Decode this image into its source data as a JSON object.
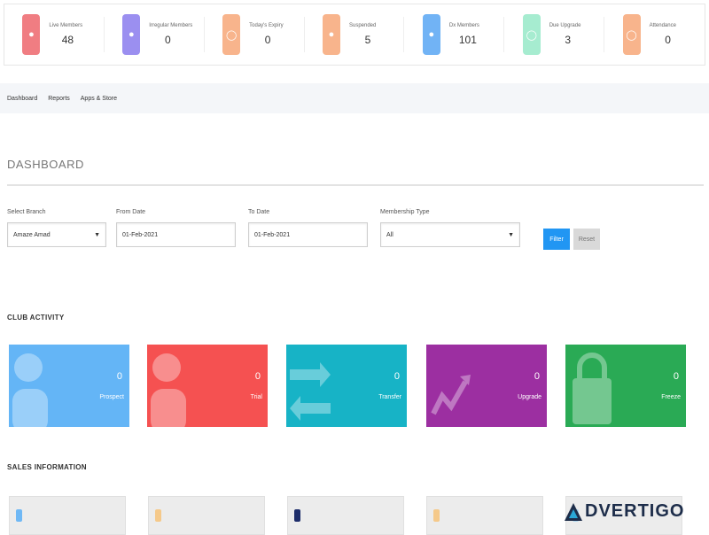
{
  "stats": [
    {
      "label": "Live Members",
      "value": "48",
      "color": "#f07d82",
      "icon": "user-icon"
    },
    {
      "label": "Irregular Members",
      "value": "0",
      "color": "#9b8ff0",
      "icon": "user-icon"
    },
    {
      "label": "Today's Expiry",
      "value": "0",
      "color": "#f8b48c",
      "icon": "clock-icon"
    },
    {
      "label": "Suspended",
      "value": "5",
      "color": "#f8b48c",
      "icon": "user-icon"
    },
    {
      "label": "Dx Members",
      "value": "101",
      "color": "#71b3f5",
      "icon": "user-icon"
    },
    {
      "label": "Due Upgrade",
      "value": "3",
      "color": "#a6ecd0",
      "icon": "clock-icon"
    },
    {
      "label": "Attendance",
      "value": "0",
      "color": "#f8b48c",
      "icon": "clock-icon"
    }
  ],
  "nav": [
    "Dashboard",
    "Reports",
    "Apps & Store"
  ],
  "page_title": "DASHBOARD",
  "filters": {
    "branch": {
      "label": "Select Branch",
      "value": "Amaze Amad"
    },
    "from_date": {
      "label": "From Date",
      "value": "01-Feb-2021"
    },
    "to_date": {
      "label": "To Date",
      "value": "01-Feb-2021"
    },
    "membership": {
      "label": "Membership Type",
      "value": "All"
    },
    "filter_label": "Filter",
    "reset_label": "Reset"
  },
  "club_activity": {
    "title": "CLUB ACTIVITY",
    "cards": [
      {
        "count": "0",
        "label": "Prospect",
        "color": "#64b5f6",
        "deco": "person"
      },
      {
        "count": "0",
        "label": "Trial",
        "color": "#f55151",
        "deco": "person"
      },
      {
        "count": "0",
        "label": "Transfer",
        "color": "#17b3c6",
        "deco": "arrows"
      },
      {
        "count": "0",
        "label": "Upgrade",
        "color": "#9c2fa1",
        "deco": "chart"
      },
      {
        "count": "0",
        "label": "Freeze",
        "color": "#2aaa55",
        "deco": "lock"
      }
    ]
  },
  "sales": {
    "title": "SALES INFORMATION",
    "cards": [
      {
        "color": "#6fb8f5"
      },
      {
        "color": "#f5c98a"
      },
      {
        "color": "#1d2d6a"
      },
      {
        "color": "#f5c98a"
      },
      {
        "color": "#b0d8f0"
      }
    ]
  },
  "watermark": "DVERTIGO"
}
